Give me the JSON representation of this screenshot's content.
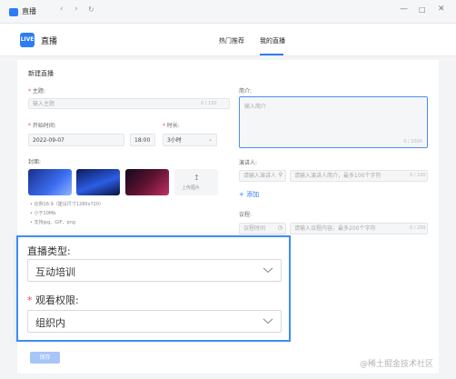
{
  "window": {
    "title": "直播"
  },
  "header": {
    "app_title": "直播",
    "app_logo_text": "LIVE",
    "tabs": [
      {
        "label": "热门推荐",
        "active": false
      },
      {
        "label": "我的直播",
        "active": true
      }
    ]
  },
  "form": {
    "section_title": "新建直播",
    "subject": {
      "label": "主题:",
      "placeholder": "输入主题",
      "counter": "0 / 100"
    },
    "start_time": {
      "label": "开始时间:",
      "date": "2022-09-07",
      "time": "18:00"
    },
    "duration": {
      "label": "时长:",
      "value": "3小时"
    },
    "cover": {
      "label": "封面:",
      "upload_label": "上传图片",
      "notes": [
        "• 比例16:9（建议尺寸1280x720）",
        "• 小于10Mb",
        "• 支持jpg、GIF、png"
      ]
    },
    "intro": {
      "label": "简介:",
      "placeholder": "输入简介",
      "counter": "0 / 2000"
    },
    "speaker": {
      "label": "演讲人:",
      "name_placeholder": "请输入演讲人",
      "desc_placeholder": "请输入演讲人简介，最多100个字符",
      "desc_counter": "0 / 100",
      "add_label": "+ 添加"
    },
    "agenda": {
      "label": "议程:",
      "time_placeholder": "议程时间",
      "content_placeholder": "请输入议程内容，最多200个字符",
      "content_counter": "0 / 200"
    },
    "save_label": "保存"
  },
  "overlay": {
    "live_type": {
      "label": "直播类型:",
      "value": "互动培训"
    },
    "view_permission": {
      "label": "观看权限:",
      "required_mark": "*",
      "value": "组织内"
    }
  },
  "watermark": "@稀土掘金技术社区",
  "colors": {
    "accent": "#2d7cf6",
    "highlight_border": "#3f8df7",
    "required": "#e34d4d"
  }
}
